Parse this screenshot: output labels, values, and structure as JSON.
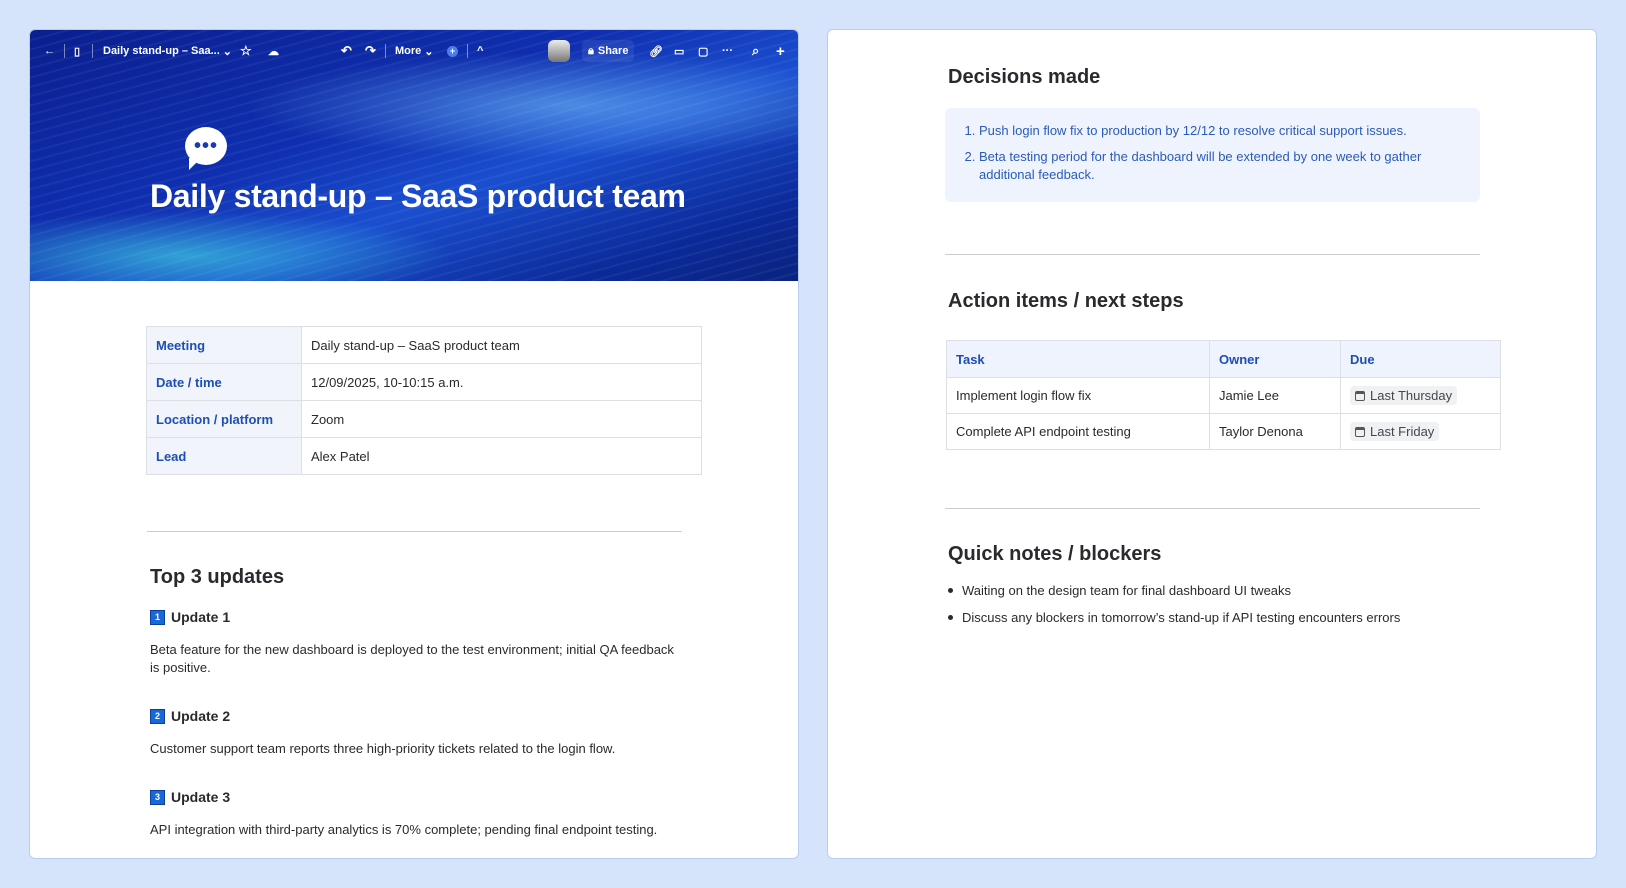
{
  "toolbar": {
    "back": "←",
    "page_title": "Daily stand-up – Saa...",
    "more": "More",
    "share": "Share"
  },
  "page": {
    "title": "Daily stand-up – SaaS product team",
    "chat_icon": "•••"
  },
  "meta": [
    {
      "key": "Meeting",
      "value": "Daily stand-up – SaaS product team"
    },
    {
      "key": "Date / time",
      "value": "12/09/2025, 10-10:15 a.m."
    },
    {
      "key": "Location / platform",
      "value": "Zoom"
    },
    {
      "key": "Lead",
      "value": "Alex Patel"
    }
  ],
  "updates": {
    "heading": "Top 3 updates",
    "items": [
      {
        "num": "1",
        "title": "Update 1",
        "text": "Beta feature for the new dashboard is deployed to the test environment; initial QA feedback is positive."
      },
      {
        "num": "2",
        "title": "Update 2",
        "text": "Customer support team reports three high-priority tickets related to the login flow."
      },
      {
        "num": "3",
        "title": "Update 3",
        "text": "API integration with third-party analytics is 70% complete; pending final endpoint testing."
      }
    ]
  },
  "decisions": {
    "heading": "Decisions made",
    "items": [
      "Push login flow fix to production by 12/12 to resolve critical support issues.",
      "Beta testing period for the dashboard will be extended by one week to gather additional feedback."
    ]
  },
  "actions": {
    "heading": "Action items / next steps",
    "columns": [
      "Task",
      "Owner",
      "Due"
    ],
    "rows": [
      {
        "task": "Implement login flow fix",
        "owner": "Jamie Lee",
        "due": "Last Thursday"
      },
      {
        "task": "Complete API endpoint testing",
        "owner": "Taylor Denona",
        "due": "Last Friday"
      }
    ]
  },
  "notes": {
    "heading": "Quick notes / blockers",
    "items": [
      "Waiting on the design team for final dashboard UI tweaks",
      "Discuss any blockers in tomorrow’s stand-up if API testing encounters errors"
    ]
  }
}
